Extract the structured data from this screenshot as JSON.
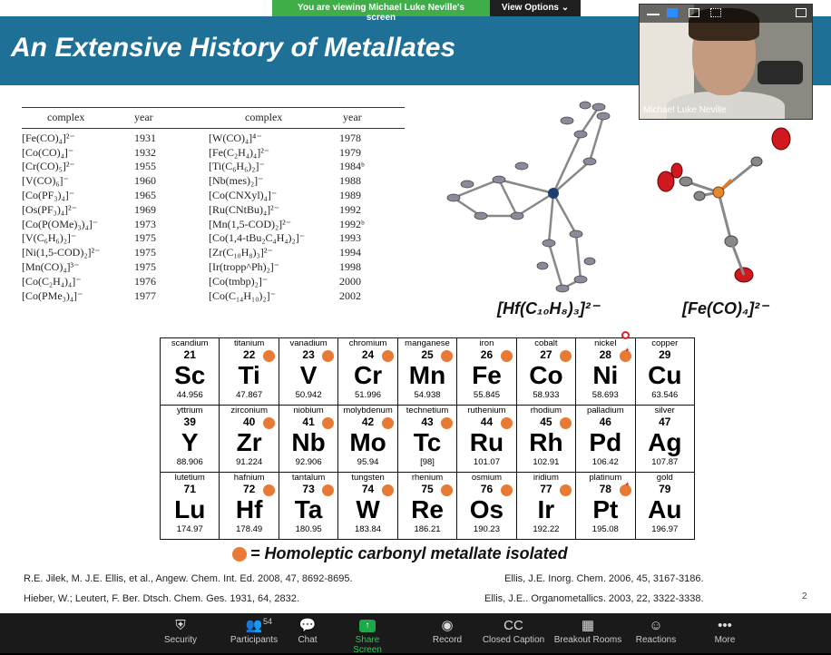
{
  "banner": {
    "viewing": "You are viewing Michael Luke Neville's screen",
    "view_options": "View Options ⌄"
  },
  "slide": {
    "title": "An Extensive History of Metallates",
    "table": {
      "headers": [
        "complex",
        "year",
        "complex",
        "year"
      ],
      "left": [
        [
          "[Fe(CO)₄]²⁻",
          "1931"
        ],
        [
          "[Co(CO)₄]⁻",
          "1932"
        ],
        [
          "[Cr(CO)₅]²⁻",
          "1955"
        ],
        [
          "[V(CO)₆]⁻",
          "1960"
        ],
        [
          "[Co(PF₃)₄]⁻",
          "1965"
        ],
        [
          "[Os(PF₃)₄]²⁻",
          "1969"
        ],
        [
          "[Co(P(OMe)₃)₄]⁻",
          "1973"
        ],
        [
          "[V(C₆H₆)₂]⁻",
          "1975"
        ],
        [
          "[Ni(1,5-COD)₂]²⁻",
          "1975"
        ],
        [
          "[Mn(CO)₄]³⁻",
          "1975"
        ],
        [
          "[Co(C₂H₄)₄]⁻",
          "1976"
        ],
        [
          "[Co(PMe₃)₄]⁻",
          "1977"
        ]
      ],
      "right": [
        [
          "[W(CO)₄]⁴⁻",
          "1978"
        ],
        [
          "[Fe(C₂H₄)₄]²⁻",
          "1979"
        ],
        [
          "[Ti(C₆H₆)₂]⁻",
          "1984ᵇ"
        ],
        [
          "[Nb(mes)₂]⁻",
          "1988"
        ],
        [
          "[Co(CNXyl)₄]⁻",
          "1989"
        ],
        [
          "[Ru(CNtBu)₄]²⁻",
          "1992"
        ],
        [
          "[Mn(1,5-COD)₂]²⁻",
          "1992ᵇ"
        ],
        [
          "[Co(1,4-tBu₂C₄H₄)₂]⁻",
          "1993"
        ],
        [
          "[Zr(C₁₀H₈)₃]²⁻",
          "1994"
        ],
        [
          "[Ir(tropp^Ph)₂]⁻",
          "1998"
        ],
        [
          "[Co(tmbp)₂]⁻",
          "2000"
        ],
        [
          "[Co(C₁₄H₁₀)₂]⁻",
          "2002"
        ]
      ]
    },
    "captions": {
      "hf": "[Hf(C₁₀H₈)₃]²⁻",
      "fe": "[Fe(CO)₄]²⁻"
    },
    "periodic": [
      [
        {
          "name": "scandium",
          "num": "21",
          "sym": "Sc",
          "mass": "44.956",
          "dot": false
        },
        {
          "name": "titanium",
          "num": "22",
          "sym": "Ti",
          "mass": "47.867",
          "dot": true
        },
        {
          "name": "vanadium",
          "num": "23",
          "sym": "V",
          "mass": "50.942",
          "dot": true
        },
        {
          "name": "chromium",
          "num": "24",
          "sym": "Cr",
          "mass": "51.996",
          "dot": true
        },
        {
          "name": "manganese",
          "num": "25",
          "sym": "Mn",
          "mass": "54.938",
          "dot": true
        },
        {
          "name": "iron",
          "num": "26",
          "sym": "Fe",
          "mass": "55.845",
          "dot": true
        },
        {
          "name": "cobalt",
          "num": "27",
          "sym": "Co",
          "mass": "58.933",
          "dot": true
        },
        {
          "name": "nickel",
          "num": "28",
          "sym": "Ni",
          "mass": "58.693",
          "dot": true,
          "star": true
        },
        {
          "name": "copper",
          "num": "29",
          "sym": "Cu",
          "mass": "63.546",
          "dot": false
        }
      ],
      [
        {
          "name": "yttrium",
          "num": "39",
          "sym": "Y",
          "mass": "88.906",
          "dot": false
        },
        {
          "name": "zirconium",
          "num": "40",
          "sym": "Zr",
          "mass": "91.224",
          "dot": true
        },
        {
          "name": "niobium",
          "num": "41",
          "sym": "Nb",
          "mass": "92.906",
          "dot": true
        },
        {
          "name": "molybdenum",
          "num": "42",
          "sym": "Mo",
          "mass": "95.94",
          "dot": true
        },
        {
          "name": "technetium",
          "num": "43",
          "sym": "Tc",
          "mass": "[98]",
          "dot": true
        },
        {
          "name": "ruthenium",
          "num": "44",
          "sym": "Ru",
          "mass": "101.07",
          "dot": true
        },
        {
          "name": "rhodium",
          "num": "45",
          "sym": "Rh",
          "mass": "102.91",
          "dot": true
        },
        {
          "name": "palladium",
          "num": "46",
          "sym": "Pd",
          "mass": "106.42",
          "dot": false
        },
        {
          "name": "silver",
          "num": "47",
          "sym": "Ag",
          "mass": "107.87",
          "dot": false
        }
      ],
      [
        {
          "name": "lutetium",
          "num": "71",
          "sym": "Lu",
          "mass": "174.97",
          "dot": false
        },
        {
          "name": "hafnium",
          "num": "72",
          "sym": "Hf",
          "mass": "178.49",
          "dot": true
        },
        {
          "name": "tantalum",
          "num": "73",
          "sym": "Ta",
          "mass": "180.95",
          "dot": true
        },
        {
          "name": "tungsten",
          "num": "74",
          "sym": "W",
          "mass": "183.84",
          "dot": true
        },
        {
          "name": "rhenium",
          "num": "75",
          "sym": "Re",
          "mass": "186.21",
          "dot": true
        },
        {
          "name": "osmium",
          "num": "76",
          "sym": "Os",
          "mass": "190.23",
          "dot": true
        },
        {
          "name": "iridium",
          "num": "77",
          "sym": "Ir",
          "mass": "192.22",
          "dot": true
        },
        {
          "name": "platinum",
          "num": "78",
          "sym": "Pt",
          "mass": "195.08",
          "dot": true,
          "star": true
        },
        {
          "name": "gold",
          "num": "79",
          "sym": "Au",
          "mass": "196.97",
          "dot": false
        }
      ]
    ],
    "legend": "= Homoleptic carbonyl metallate isolated",
    "refs": {
      "r1": "R.E. Jilek, M. J.E. Ellis, et al., Angew. Chem. Int. Ed. 2008, 47, 8692-8695.",
      "r2": "Hieber, W.; Leutert, F. Ber. Dtsch. Chem. Ges. 1931, 64, 2832.",
      "r3": "Ellis, J.E. Inorg. Chem. 2006, 45, 3167-3186.",
      "r4": "Ellis, J.E.. Organometallics. 2003, 22, 3322-3338."
    },
    "page": "2"
  },
  "video": {
    "name": "Michael Luke Neville"
  },
  "toolbar": [
    {
      "label": "Security",
      "icon": "⛨"
    },
    {
      "label": "Participants",
      "icon": "👥",
      "count": "54"
    },
    {
      "label": "Chat",
      "icon": "💬"
    },
    {
      "label": "Share Screen",
      "icon": "↑"
    },
    {
      "label": "Record",
      "icon": "◉"
    },
    {
      "label": "Closed Caption",
      "icon": "CC"
    },
    {
      "label": "Breakout Rooms",
      "icon": "▦"
    },
    {
      "label": "Reactions",
      "icon": "☺"
    },
    {
      "label": "More",
      "icon": "•••"
    }
  ]
}
